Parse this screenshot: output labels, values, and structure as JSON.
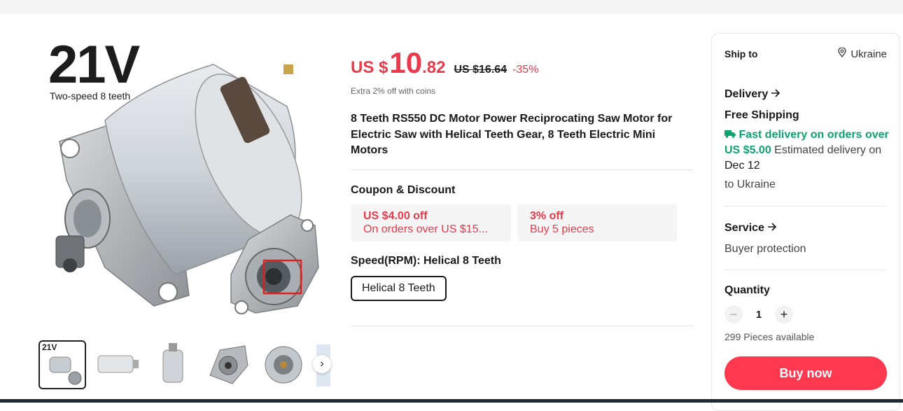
{
  "product": {
    "image_badge": "21V",
    "image_caption": "Two-speed 8 teeth",
    "title": "8 Teeth RS550 DC Motor Power Reciprocating Saw Motor for Electric Saw with Helical Teeth Gear, 8 Teeth Electric Mini Motors"
  },
  "price": {
    "currency": "US $",
    "integer": "10",
    "decimal": ".82",
    "original": "US $16.64",
    "discount": "-35%",
    "coins_note": "Extra 2% off with coins"
  },
  "coupons": {
    "label": "Coupon & Discount",
    "items": [
      {
        "title": "US $4.00 off",
        "subtitle": "On orders over US $15..."
      },
      {
        "title": "3% off",
        "subtitle": "Buy 5 pieces"
      }
    ]
  },
  "variant": {
    "label": "Speed(RPM): Helical 8 Teeth",
    "option": "Helical 8 Teeth"
  },
  "shipping": {
    "ship_to_label": "Ship to",
    "ship_to_value": "Ukraine",
    "delivery_label": "Delivery",
    "free_shipping": "Free Shipping",
    "fast_delivery": "Fast delivery on orders over US $5.00",
    "estimated": "Estimated delivery on",
    "date": "Dec 12",
    "destination": "to Ukraine"
  },
  "service": {
    "label": "Service",
    "value": "Buyer protection"
  },
  "quantity": {
    "label": "Quantity",
    "value": "1",
    "available": "299 Pieces available"
  },
  "actions": {
    "buy_now": "Buy now"
  },
  "colors": {
    "accent_red": "#e83a4a",
    "buy_button": "#fd384f",
    "green": "#0ea36e"
  },
  "icons": {
    "location": "map-pin-icon",
    "arrow": "arrow-right-icon",
    "truck": "truck-icon",
    "next": "chevron-right-icon"
  }
}
